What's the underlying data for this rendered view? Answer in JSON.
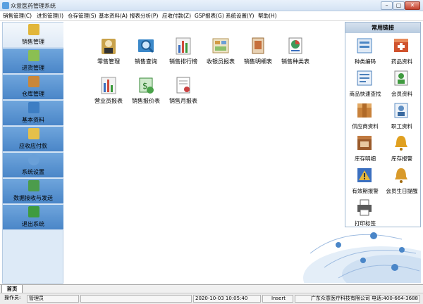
{
  "window": {
    "title": "众意医药管理系统",
    "min": "–",
    "max": "▢",
    "close": "✕"
  },
  "menu": [
    "销售管理(C)",
    "进货管理(I)",
    "仓存管理(S)",
    "基本资料(A)",
    "报表分析(P)",
    "应收付款(Z)",
    "GSP报表(G)",
    "系统设置(Y)",
    "帮助(H)"
  ],
  "sidebar": {
    "items": [
      {
        "label": "销售管理",
        "icon": "calculator-icon",
        "color": "#e2b63a",
        "active": true
      },
      {
        "label": "进货管理",
        "icon": "incoming-goods-icon",
        "color": "#8bbf52"
      },
      {
        "label": "仓库管理",
        "icon": "warehouse-icon",
        "color": "#c9873a"
      },
      {
        "label": "基本资料",
        "icon": "profile-card-icon",
        "color": "#3d7ec4"
      },
      {
        "label": "应收应付款",
        "icon": "coins-icon",
        "color": "#e5c04a"
      },
      {
        "label": "系统设置",
        "icon": "settings-gear-icon",
        "color": "#6aa0d8"
      },
      {
        "label": "数据接收与发送",
        "icon": "network-icon",
        "color": "#4c9c4c"
      },
      {
        "label": "退出系统",
        "icon": "exit-door-icon",
        "color": "#3f9b3f"
      }
    ]
  },
  "main": {
    "tiles": [
      {
        "label": "零售管理",
        "icon": "retail-man-icon",
        "color": "#c9a24a"
      },
      {
        "label": "销售查询",
        "icon": "search-query-icon",
        "color": "#3b88c9"
      },
      {
        "label": "销售排行榜",
        "icon": "bar-ranking-icon",
        "color": "#4a7fc1"
      },
      {
        "label": "收银员报表",
        "icon": "cashier-report-icon",
        "color": "#d29b45"
      },
      {
        "label": "销售明细表",
        "icon": "sales-detail-icon",
        "color": "#c66f3c"
      },
      {
        "label": "销售种类表",
        "icon": "category-chart-icon",
        "color": "#3e9a5a"
      },
      {
        "label": "营业员报表",
        "icon": "clerk-report-icon",
        "color": "#5b8fcb"
      },
      {
        "label": "销售报价表",
        "icon": "price-quote-icon",
        "color": "#4aa34a"
      },
      {
        "label": "销售月报表",
        "icon": "monthly-report-icon",
        "color": "#c94040"
      }
    ]
  },
  "quick_links": {
    "title": "常用链接",
    "items": [
      {
        "label": "种类编码",
        "icon": "category-code-icon",
        "color": "#4b86c4"
      },
      {
        "label": "药品资料",
        "icon": "medicine-box-icon",
        "color": "#d0532e"
      },
      {
        "label": "商品快速查找",
        "icon": "quick-find-icon",
        "color": "#4a7fba"
      },
      {
        "label": "会员资料",
        "icon": "member-icon",
        "color": "#3f9a3f"
      },
      {
        "label": "供应商资料",
        "icon": "supplier-icon",
        "color": "#c8813a"
      },
      {
        "label": "职工资料",
        "icon": "employee-icon",
        "color": "#5f8fc4"
      },
      {
        "label": "库存明细",
        "icon": "stock-detail-icon",
        "color": "#9a5a2a"
      },
      {
        "label": "库存报警",
        "icon": "stock-alarm-icon",
        "color": "#e0a020"
      },
      {
        "label": "有效期报警",
        "icon": "expiry-warning-icon",
        "color": "#e5b83a"
      },
      {
        "label": "会员生日提醒",
        "icon": "birthday-bell-icon",
        "color": "#d99a2a"
      },
      {
        "label": "打印标签",
        "icon": "print-label-icon",
        "color": "#5a5a5a"
      }
    ]
  },
  "tabs": {
    "home": "首页"
  },
  "status": {
    "operator_label": "操作员:",
    "operator": "管理员",
    "datetime": "2020-10-03 10:05:40",
    "mode": "Insert",
    "company": "广东众意医疗科技有限公司 电话:400-664-3688"
  }
}
